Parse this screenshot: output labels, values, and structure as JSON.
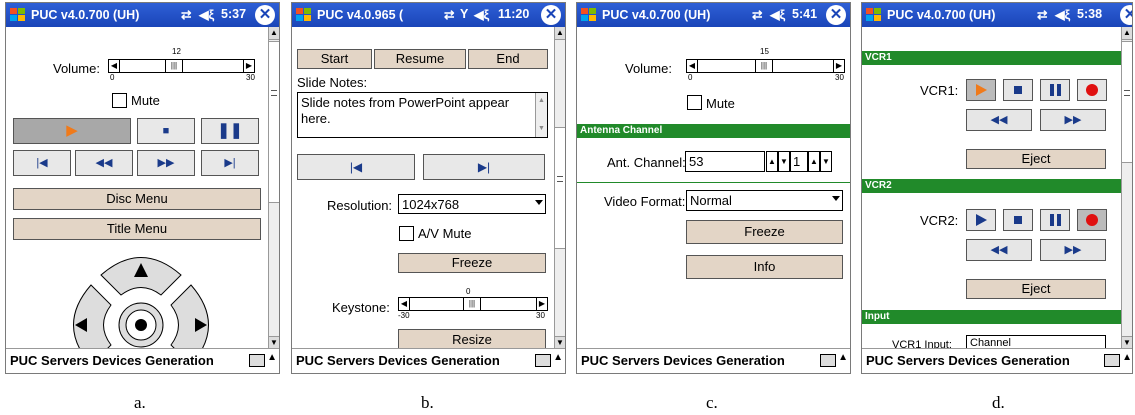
{
  "taskbar_menu": "PUC Servers Devices Generation",
  "screens": [
    {
      "caption": "a.",
      "title": "PUC v4.0.700 (UH)",
      "time": "5:37",
      "volume_label": "Volume:",
      "volume_value": "12",
      "volume_min": "0",
      "volume_max": "30",
      "mute_label": "Mute",
      "disc_menu": "Disc Menu",
      "title_menu": "Title Menu"
    },
    {
      "caption": "b.",
      "title": "PUC v4.0.965 (",
      "time": "11:20",
      "start": "Start",
      "resume": "Resume",
      "end": "End",
      "slide_notes_label": "Slide Notes:",
      "slide_notes_text": "Slide notes from PowerPoint appear here.",
      "resolution_label": "Resolution:",
      "resolution_value": "1024x768",
      "av_mute": "A/V Mute",
      "freeze": "Freeze",
      "keystone_label": "Keystone:",
      "keystone_value": "0",
      "keystone_min": "-30",
      "keystone_max": "30",
      "resize": "Resize"
    },
    {
      "caption": "c.",
      "title": "PUC v4.0.700 (UH)",
      "time": "5:41",
      "volume_label": "Volume:",
      "volume_value": "15",
      "volume_min": "0",
      "volume_max": "30",
      "mute_label": "Mute",
      "antenna_header": "Antenna Channel",
      "ant_label": "Ant. Channel:",
      "ant_value": "53",
      "ant_sub": "1",
      "video_format_label": "Video Format:",
      "video_format_value": "Normal",
      "freeze": "Freeze",
      "info": "Info"
    },
    {
      "caption": "d.",
      "title": "PUC v4.0.700 (UH)",
      "time": "5:38",
      "vcr1_header": "VCR1",
      "vcr1_label": "VCR1:",
      "eject1": "Eject",
      "vcr2_header": "VCR2",
      "vcr2_label": "VCR2:",
      "eject2": "Eject",
      "input_header": "Input",
      "input_partial_label": "VCR1 Input:",
      "input_partial_value": "Channel"
    }
  ],
  "colors": {
    "titlebar": "#1a45b8",
    "section_green": "#218a2a",
    "button_tan": "#e3d5c6",
    "play_orange": "#f07a1a",
    "record_red": "#e01010"
  }
}
